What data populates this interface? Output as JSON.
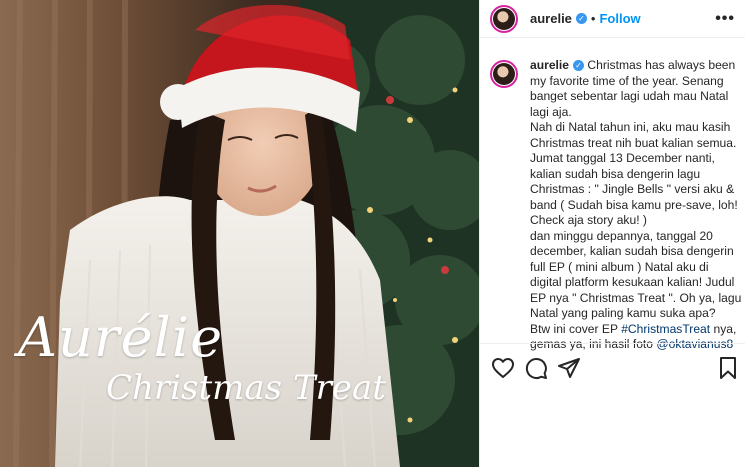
{
  "post": {
    "username": "aurelie",
    "verified_mark": "✓",
    "separator": "•",
    "follow_label": "Follow",
    "more_label": "•••"
  },
  "image": {
    "overlay_title": "Aurélie",
    "overlay_subtitle": "Christmas Treat"
  },
  "caption": {
    "username": "aurelie",
    "lines": [
      "Christmas has always been",
      "my favorite time of the year. Senang",
      "banget sebentar lagi udah mau Natal",
      "lagi aja.",
      "Nah di Natal tahun ini, aku mau kasih",
      "Christmas treat nih buat kalian semua.",
      "Jumat tanggal 13 December nanti,",
      "kalian sudah bisa dengerin lagu",
      "Christmas : \" Jingle Bells \" versi aku &",
      "band ( Sudah bisa kamu pre-save, loh!",
      "Check aja story aku! )",
      "dan minggu depannya, tanggal 20",
      "december, kalian sudah bisa dengerin",
      "full EP ( mini album ) Natal aku di",
      "digital platform kesukaan kalian! Judul",
      "EP nya \" Christmas Treat \". Oh ya, lagu",
      "Natal yang paling kamu suka apa?"
    ],
    "line17_prefix": "Btw ini cover EP",
    "hashtag": "#ChristmasTreat",
    "line17_suffix": " nya,",
    "line18_prefix": "gemas ya, ini hasil foto ",
    "mention": "@oktavianus8"
  },
  "actions": {
    "like_icon": "heart-icon",
    "comment_icon": "comment-icon",
    "share_icon": "paper-plane-icon",
    "save_icon": "bookmark-icon"
  },
  "colors": {
    "link_blue": "#0095f6",
    "verified_blue": "#3897f0",
    "text": "#262626"
  }
}
